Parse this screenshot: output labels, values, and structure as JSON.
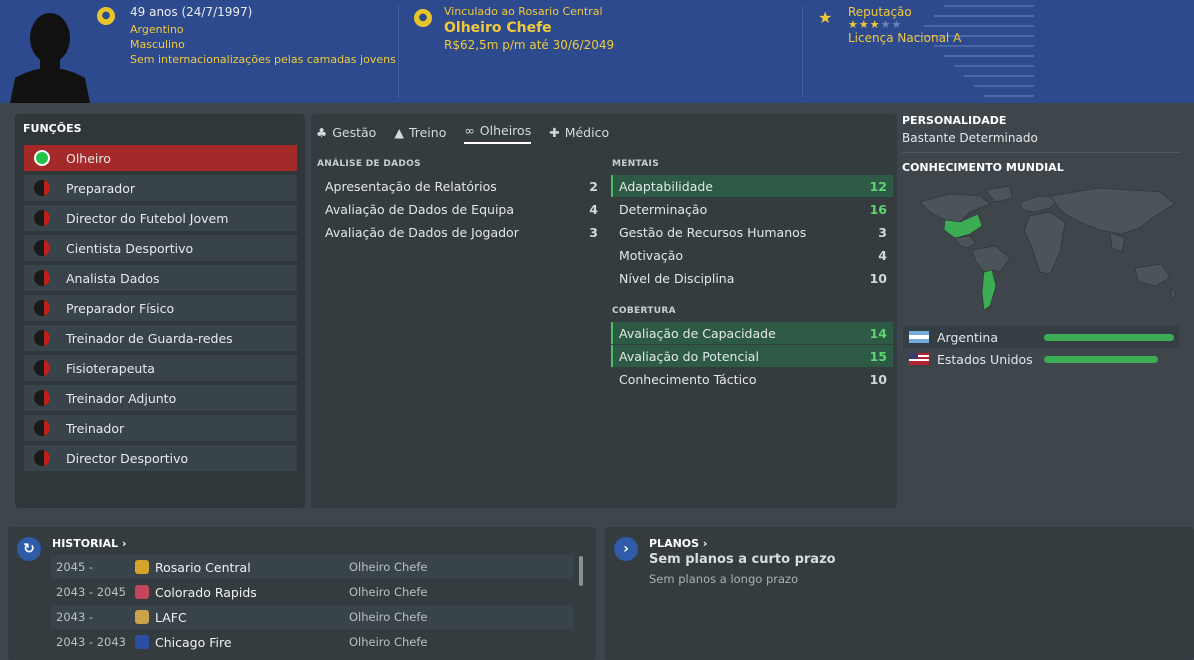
{
  "header": {
    "age": "49 anos (24/7/1997)",
    "nationality": "Argentino",
    "gender": "Masculino",
    "youth_caps": "Sem internacionalizações pelas camadas jovens",
    "contract_label": "Vinculado ao Rosario Central",
    "job_title": "Olheiro Chefe",
    "salary": "R$62,5m p/m até 30/6/2049",
    "reputation_label": "Reputação",
    "reputation_stars": 3,
    "reputation_max": 5,
    "license": "Licença Nacional A"
  },
  "functions": {
    "title": "FUNÇÕES",
    "items": [
      {
        "label": "Olheiro",
        "active": true
      },
      {
        "label": "Preparador"
      },
      {
        "label": "Director do Futebol Jovem"
      },
      {
        "label": "Cientista Desportivo"
      },
      {
        "label": "Analista Dados"
      },
      {
        "label": "Preparador Físico"
      },
      {
        "label": "Treinador de Guarda-redes"
      },
      {
        "label": "Fisioterapeuta"
      },
      {
        "label": "Treinador Adjunto"
      },
      {
        "label": "Treinador"
      },
      {
        "label": "Director Desportivo"
      }
    ]
  },
  "tabs": [
    {
      "label": "Gestão"
    },
    {
      "label": "Treino"
    },
    {
      "label": "Olheiros",
      "active": true
    },
    {
      "label": "Médico"
    }
  ],
  "analysis": {
    "title": "ANÁLISE DE DADOS",
    "items": [
      {
        "label": "Apresentação de Relatórios",
        "value": "2"
      },
      {
        "label": "Avaliação de Dados de Equipa",
        "value": "4"
      },
      {
        "label": "Avaliação de Dados de Jogador",
        "value": "3"
      }
    ]
  },
  "mental": {
    "title": "MENTAIS",
    "items": [
      {
        "label": "Adaptabilidade",
        "value": "12"
      },
      {
        "label": "Determinação",
        "value": "16"
      },
      {
        "label": "Gestão de Recursos Humanos",
        "value": "3"
      },
      {
        "label": "Motivação",
        "value": "4"
      },
      {
        "label": "Nível de Disciplina",
        "value": "10"
      }
    ]
  },
  "coverage": {
    "title": "COBERTURA",
    "items": [
      {
        "label": "Avaliação de Capacidade",
        "value": "14"
      },
      {
        "label": "Avaliação do Potencial",
        "value": "15"
      },
      {
        "label": "Conhecimento Táctico",
        "value": "10"
      }
    ]
  },
  "personality": {
    "title": "PERSONALIDADE",
    "value": "Bastante Determinado"
  },
  "world_knowledge": {
    "title": "CONHECIMENTO MUNDIAL",
    "countries": [
      {
        "name": "Argentina",
        "level": 1.0
      },
      {
        "name": "Estados Unidos",
        "level": 0.88
      }
    ]
  },
  "history": {
    "title": "HISTORIAL ›",
    "rows": [
      {
        "years": "2045 -",
        "club": "Rosario Central",
        "role": "Olheiro Chefe"
      },
      {
        "years": "2043 - 2045",
        "club": "Colorado Rapids",
        "role": "Olheiro Chefe"
      },
      {
        "years": "2043 -",
        "club": "LAFC",
        "role": "Olheiro Chefe"
      },
      {
        "years": "2043 - 2043",
        "club": "Chicago Fire",
        "role": "Olheiro Chefe"
      }
    ]
  },
  "plans": {
    "title": "PLANOS ›",
    "short_term": "Sem planos a curto prazo",
    "long_term": "Sem planos a longo prazo"
  },
  "colors": {
    "header_blue": "#2e4a8e",
    "accent_yellow": "#f0c93a",
    "active_red": "#a42a2a",
    "highlight_green": "#5fd46e"
  }
}
